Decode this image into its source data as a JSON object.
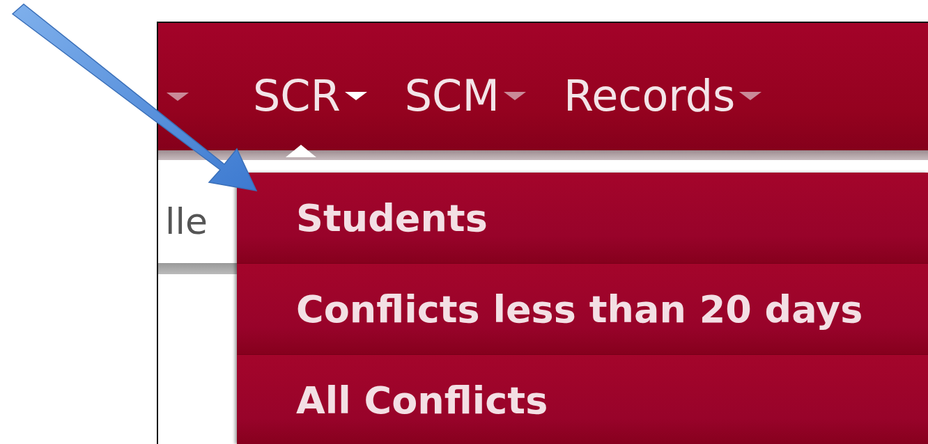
{
  "nav": {
    "items": [
      {
        "label": "SCR",
        "selected": true
      },
      {
        "label": "SCM",
        "selected": false
      },
      {
        "label": "Records",
        "selected": false
      }
    ]
  },
  "side_text": "lle",
  "dropdown": {
    "items": [
      {
        "label": "Students"
      },
      {
        "label": "Conflicts less than 20 days"
      },
      {
        "label": "All Conflicts"
      }
    ]
  }
}
